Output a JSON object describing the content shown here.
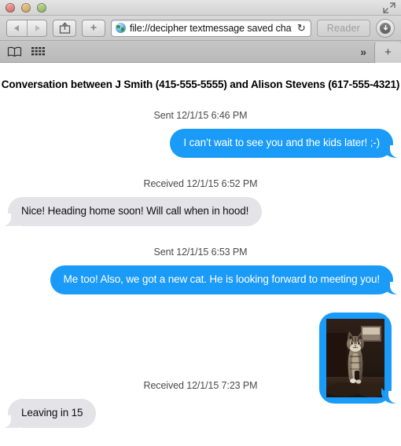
{
  "window": {
    "traffic_lights": [
      "close",
      "minimize",
      "zoom"
    ],
    "fullscreen_label": "Enter Full Screen"
  },
  "toolbar": {
    "back_label": "Back",
    "forward_label": "Forward",
    "share_label": "Share",
    "newtab_label": "+",
    "url": "file://decipher textmessage saved chat",
    "reload_label": "↻",
    "reader_label": "Reader",
    "downloads_label": "Downloads"
  },
  "bookmarks_bar": {
    "sidebar_label": "Show Sidebar",
    "topsites_label": "Top Sites",
    "overflow_label": "»",
    "newtab_label": "+"
  },
  "page": {
    "title": "Conversation between J Smith (415-555-5555) and Alison Stevens (617-555-4321)",
    "messages": [
      {
        "stamp": "Sent 12/1/15 6:46 PM",
        "direction": "sent",
        "type": "text",
        "text": "I can’t wait to see you and the kids later! ;-)"
      },
      {
        "stamp": "Received 12/1/15 6:52 PM",
        "direction": "received",
        "type": "text",
        "text": "Nice! Heading home soon! Will call when in hood!"
      },
      {
        "stamp": "Sent 12/1/15 6:53 PM",
        "direction": "sent",
        "type": "text",
        "text": "Me too! Also, we got a new cat. He is looking forward to meeting you!"
      },
      {
        "stamp": "",
        "direction": "sent",
        "type": "photo",
        "text": "",
        "photo_alt": "Photo of a tabby cat standing in a dim room"
      },
      {
        "stamp": "Received 12/1/15 7:23 PM",
        "direction": "received",
        "type": "text",
        "text": "Leaving in 15"
      }
    ]
  },
  "colors": {
    "sent_bubble": "#1b9bf8",
    "received_bubble": "#e3e3e8",
    "sent_text": "#ffffff",
    "received_text": "#111111",
    "page_background": "#ffffff",
    "chrome_background": "#c9c9c9"
  }
}
